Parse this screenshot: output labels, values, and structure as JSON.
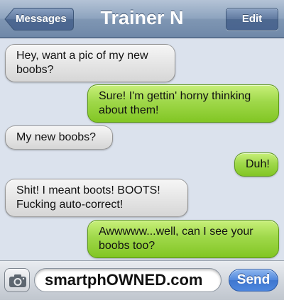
{
  "header": {
    "back_label": "Messages",
    "title": "Trainer N",
    "edit_label": "Edit"
  },
  "messages": [
    {
      "direction": "in",
      "text_lines": [
        "Hey, want a pic of my new",
        "boobs?"
      ]
    },
    {
      "direction": "out",
      "text_lines": [
        "Sure! I'm gettin' horny thinking",
        "about them!"
      ]
    },
    {
      "direction": "in",
      "text_lines": [
        "My new boobs?"
      ]
    },
    {
      "direction": "out",
      "text_lines": [
        "Duh!"
      ]
    },
    {
      "direction": "in",
      "text_lines": [
        "Shit! I meant boots! BOOTS!",
        "Fucking auto-correct!"
      ]
    },
    {
      "direction": "out",
      "text_lines": [
        "Awwwww...well, can I see your",
        "boobs too?"
      ]
    }
  ],
  "composer": {
    "camera_icon": "camera-icon",
    "input_value": "smartphOWNED.com",
    "send_label": "Send"
  },
  "colors": {
    "incoming_bubble": "#e6e6e6",
    "outgoing_bubble": "#9fd84a",
    "navbar": "#8ea4bf",
    "send_button": "#4f86dc"
  }
}
